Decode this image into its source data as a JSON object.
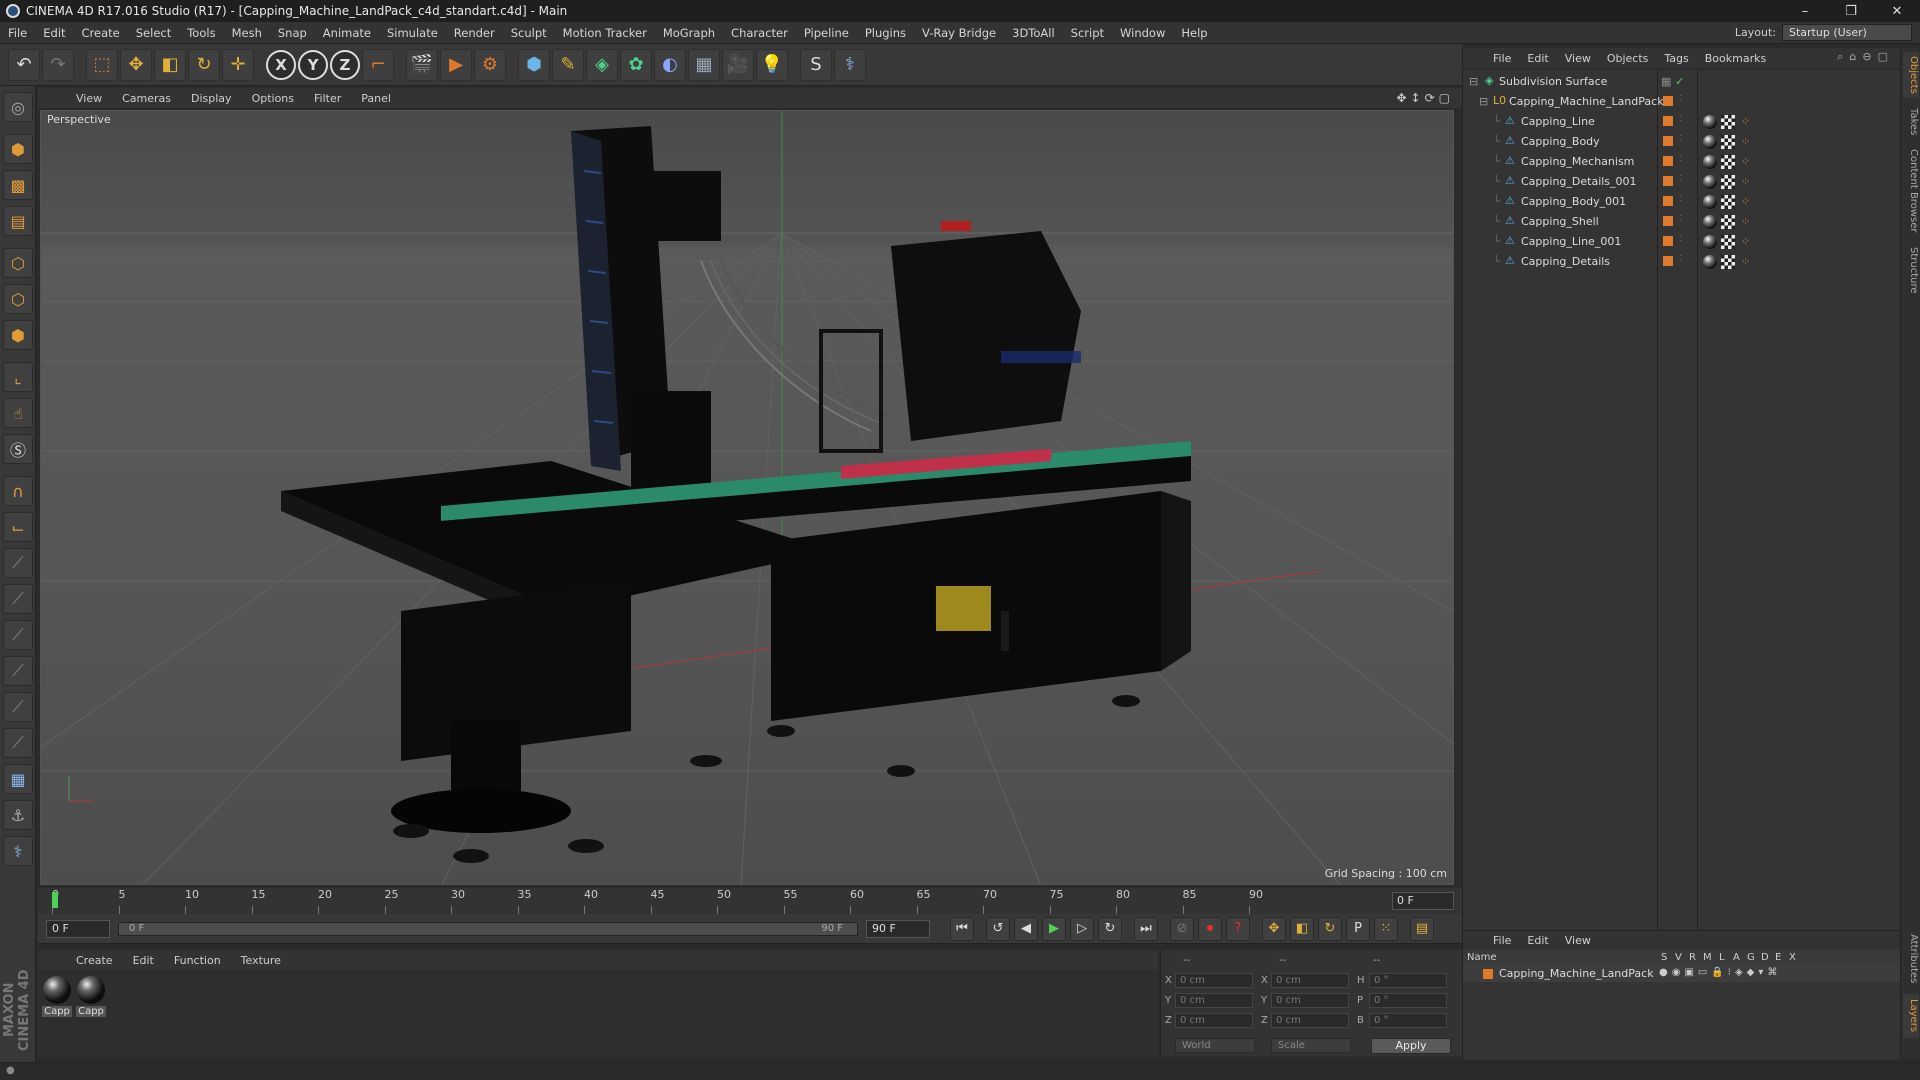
{
  "window": {
    "title": "CINEMA 4D R17.016 Studio (R17) - [Capping_Machine_LandPack_c4d_standart.c4d] - Main",
    "controls": [
      "–",
      "❐",
      "✕"
    ]
  },
  "menubar": {
    "items": [
      "File",
      "Edit",
      "Create",
      "Select",
      "Tools",
      "Mesh",
      "Snap",
      "Animate",
      "Simulate",
      "Render",
      "Sculpt",
      "Motion Tracker",
      "MoGraph",
      "Character",
      "Pipeline",
      "Plugins",
      "V-Ray Bridge",
      "3DToAll",
      "Script",
      "Window",
      "Help"
    ],
    "layout_label": "Layout:",
    "layout_value": "Startup (User)"
  },
  "toolbar": {
    "axis_x": "X",
    "axis_y": "Y",
    "axis_z": "Z"
  },
  "viewport": {
    "menu": [
      "View",
      "Cameras",
      "Display",
      "Options",
      "Filter",
      "Panel"
    ],
    "label": "Perspective",
    "grid_spacing": "Grid Spacing : 100 cm"
  },
  "timeline": {
    "ticks": [
      "0",
      "5",
      "10",
      "15",
      "20",
      "25",
      "30",
      "35",
      "40",
      "45",
      "50",
      "55",
      "60",
      "65",
      "70",
      "75",
      "80",
      "85",
      "90"
    ],
    "current_frame": "0 F"
  },
  "transport": {
    "start_field": "0 F",
    "range_start": "0 F",
    "range_end": "90 F",
    "end_field": "90 F"
  },
  "material_manager": {
    "menu": [
      "Create",
      "Edit",
      "Function",
      "Texture"
    ],
    "materials": [
      "Capp",
      "Capp"
    ]
  },
  "coordinates": {
    "header_left": "--",
    "header_mid": "--",
    "header_right": "--",
    "rows": [
      {
        "a": "X",
        "av": "0 cm",
        "b": "X",
        "bv": "0 cm",
        "c": "H",
        "cv": "0 °"
      },
      {
        "a": "Y",
        "av": "0 cm",
        "b": "Y",
        "bv": "0 cm",
        "c": "P",
        "cv": "0 °"
      },
      {
        "a": "Z",
        "av": "0 cm",
        "b": "Z",
        "bv": "0 cm",
        "c": "B",
        "cv": "0 °"
      }
    ],
    "world": "World",
    "scale": "Scale",
    "apply": "Apply"
  },
  "object_manager": {
    "menu": [
      "File",
      "Edit",
      "View",
      "Objects",
      "Tags",
      "Bookmarks"
    ],
    "root": "Subdivision Surface",
    "group": "Capping_Machine_LandPack",
    "objects": [
      "Capping_Line",
      "Capping_Body",
      "Capping_Mechanism",
      "Capping_Details_001",
      "Capping_Body_001",
      "Capping_Shell",
      "Capping_Line_001",
      "Capping_Details"
    ]
  },
  "layer_manager": {
    "menu": [
      "File",
      "Edit",
      "View"
    ],
    "columns": [
      "Name",
      "S",
      "V",
      "R",
      "M",
      "L",
      "A",
      "G",
      "D",
      "E",
      "X"
    ],
    "layer": "Capping_Machine_LandPack"
  },
  "right_tabs": [
    "Objects",
    "Takes",
    "Content Browser",
    "Structure",
    "Attributes",
    "Layers"
  ],
  "colors": {
    "accent_orange": "#e07a2a",
    "ui_bg": "#333333"
  }
}
